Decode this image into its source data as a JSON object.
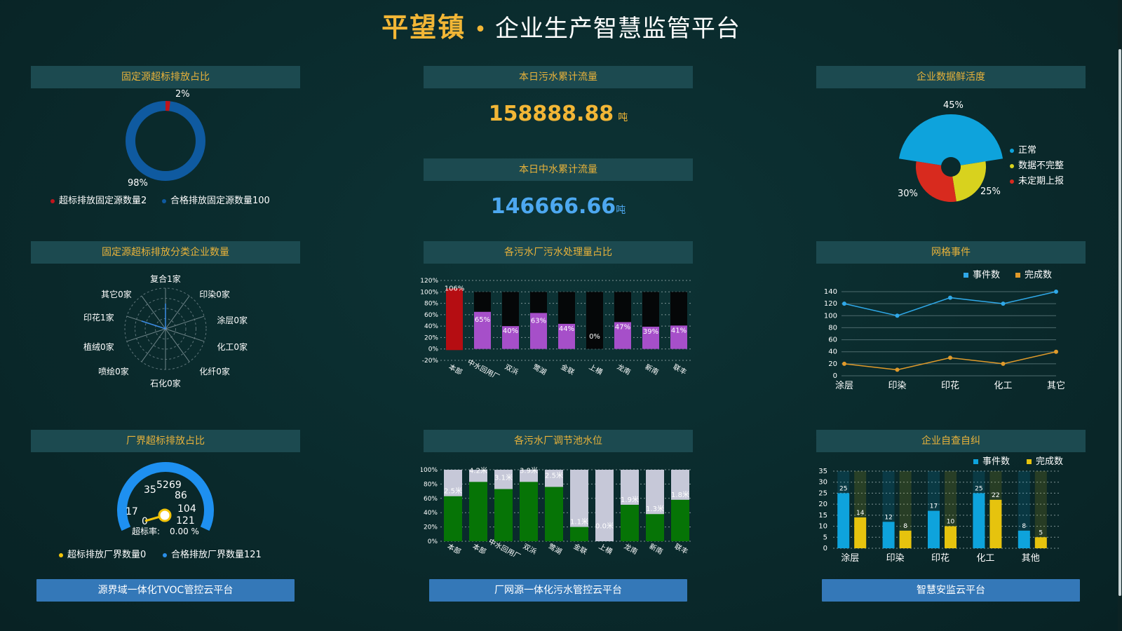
{
  "header": {
    "title_main": "平望镇",
    "title_dot": "•",
    "title_sub": "企业生产智慧监管平台"
  },
  "colors": {
    "panel_title_bg": "#1c4a50",
    "accent_orange": "#f2b636",
    "accent_blue": "#4da8f0",
    "button": "#3478b8"
  },
  "panel1": {
    "title": "固定源超标排放占比",
    "label_small": "2%",
    "label_large": "98%",
    "legend": [
      {
        "text": "超标排放固定源数量2",
        "color": "#c0141b"
      },
      {
        "text": "合格排放固定源数量100",
        "color": "#0f5aa0"
      }
    ]
  },
  "panel2": {
    "title1": "本日污水累计流量",
    "value1": "158888.88",
    "unit1": "吨",
    "title2": "本日中水累计流量",
    "value2": "146666.66",
    "unit2": "吨"
  },
  "panel3": {
    "title": "企业数据鲜活度",
    "labels": [
      "45%",
      "25%",
      "30%"
    ],
    "legend": [
      {
        "text": "正常",
        "color": "#0ea3dc"
      },
      {
        "text": "数据不完整",
        "color": "#d8d21e"
      },
      {
        "text": "未定期上报",
        "color": "#d82a1e"
      }
    ]
  },
  "panel4": {
    "title": "固定源超标排放分类企业数量",
    "labels": [
      "复合1家",
      "印染0家",
      "涂层0家",
      "化工0家",
      "化纤0家",
      "石化0家",
      "喷绘0家",
      "植绒0家",
      "印花1家",
      "其它0家"
    ]
  },
  "panel5": {
    "title": "各污水厂污水处理量占比"
  },
  "panel6": {
    "title": "网格事件"
  },
  "panel7": {
    "title": "厂界超标排放占比",
    "gauge_labels": [
      "17",
      "35",
      "52",
      "69",
      "86",
      "104",
      "121",
      "0"
    ],
    "rate_label": "超标率:",
    "rate_value": "0.00 %",
    "legend": [
      {
        "text": "超标排放厂界数量0",
        "color": "#f2c40a"
      },
      {
        "text": "合格排放厂界数量121",
        "color": "#2a8ee8"
      }
    ]
  },
  "panel8": {
    "title": "各污水厂调节池水位"
  },
  "panel9": {
    "title": "企业自查自纠"
  },
  "buttons": {
    "btn1": "源界域一体化TVOC管控云平台",
    "btn2": "厂网源一体化污水管控云平台",
    "btn3": "智慧安监云平台"
  },
  "chart_data": [
    {
      "type": "pie",
      "title": "固定源超标排放占比",
      "categories": [
        "超标排放固定源",
        "合格排放固定源"
      ],
      "values": [
        2,
        100
      ],
      "percent_labels": [
        "2%",
        "98%"
      ]
    },
    {
      "type": "pie",
      "title": "企业数据鲜活度",
      "categories": [
        "正常",
        "数据不完整",
        "未定期上报"
      ],
      "values": [
        45,
        25,
        30
      ]
    },
    {
      "type": "radar",
      "title": "固定源超标排放分类企业数量",
      "categories": [
        "复合",
        "印染",
        "涂层",
        "化工",
        "化纤",
        "石化",
        "喷绘",
        "植绒",
        "印花",
        "其它"
      ],
      "values": [
        1,
        0,
        0,
        0,
        0,
        0,
        0,
        0,
        1,
        0
      ]
    },
    {
      "type": "bar",
      "title": "各污水厂污水处理量占比",
      "categories": [
        "本部",
        "中水回用厂",
        "双浜",
        "莺湖",
        "金联",
        "上横",
        "龙南",
        "新南",
        "联丰"
      ],
      "values": [
        106,
        65,
        40,
        63,
        44,
        0,
        47,
        39,
        41
      ],
      "value_labels": [
        "106%",
        "65%",
        "40%",
        "63%",
        "44%",
        "0%",
        "47%",
        "39%",
        "41%"
      ],
      "ylim": [
        -20,
        120
      ],
      "yticks": [
        "120%",
        "100%",
        "80%",
        "60%",
        "40%",
        "20%",
        "0%",
        "-20%"
      ]
    },
    {
      "type": "line",
      "title": "网格事件",
      "x": [
        "涂层",
        "印染",
        "印花",
        "化工",
        "其它"
      ],
      "series": [
        {
          "name": "事件数",
          "values": [
            120,
            100,
            130,
            120,
            140
          ],
          "color": "#2fa8e8"
        },
        {
          "name": "完成数",
          "values": [
            20,
            10,
            30,
            20,
            40
          ],
          "color": "#e09a2a"
        }
      ],
      "ylim": [
        0,
        140
      ],
      "yticks": [
        "140",
        "120",
        "100",
        "80",
        "60",
        "40",
        "20",
        "0"
      ]
    },
    {
      "type": "gauge",
      "title": "厂界超标排放占比",
      "min": 0,
      "max": 121,
      "value": 0,
      "rate": "0.00 %"
    },
    {
      "type": "bar",
      "title": "各污水厂调节池水位",
      "categories": [
        "本部",
        "本部",
        "中水回用厂",
        "双浜",
        "莺湖",
        "金联",
        "上横",
        "龙南",
        "新南",
        "联丰"
      ],
      "values": [
        63,
        83,
        73,
        83,
        76,
        20,
        0,
        51,
        38,
        58
      ],
      "value_labels": [
        "2.5米",
        "4.2米",
        "3.1米",
        "3.9米",
        "2.5米",
        "1.1米",
        "0.0米",
        "1.9米",
        "1.3米",
        "1.8米"
      ],
      "ylim": [
        0,
        100
      ],
      "yticks": [
        "100%",
        "80%",
        "60%",
        "40%",
        "20%",
        "0%"
      ]
    },
    {
      "type": "bar",
      "title": "企业自查自纠",
      "categories": [
        "涂层",
        "印染",
        "印花",
        "化工",
        "其他"
      ],
      "series": [
        {
          "name": "事件数",
          "values": [
            25,
            12,
            17,
            25,
            8
          ],
          "color": "#0ea3dc"
        },
        {
          "name": "完成数",
          "values": [
            14,
            8,
            10,
            22,
            5
          ],
          "color": "#e6c30e"
        }
      ],
      "ylim": [
        0,
        35
      ],
      "yticks": [
        "35",
        "30",
        "25",
        "20",
        "15",
        "10",
        "5",
        "0"
      ]
    }
  ]
}
